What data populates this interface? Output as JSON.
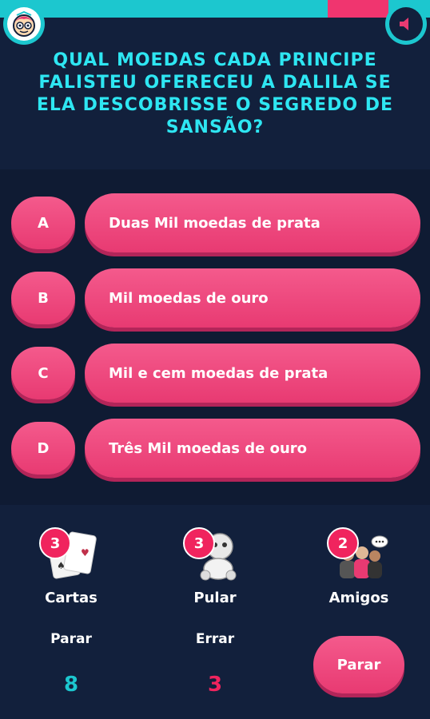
{
  "question": "QUAL MOEDAS CADA PRINCIPE FALISTEU OFERECEU A DALILA SE ELA DESCOBRISSE O SEGREDO DE SANSÃO?",
  "answers": [
    {
      "letter": "A",
      "text": "Duas Mil moedas de prata"
    },
    {
      "letter": "B",
      "text": "Mil moedas de ouro"
    },
    {
      "letter": "C",
      "text": "Mil e cem moedas de prata"
    },
    {
      "letter": "D",
      "text": "Três Mil moedas de ouro"
    }
  ],
  "lifelines": [
    {
      "label": "Cartas",
      "count": "3",
      "icon": "cards-icon"
    },
    {
      "label": "Pular",
      "count": "3",
      "icon": "skip-icon"
    },
    {
      "label": "Amigos",
      "count": "2",
      "icon": "friends-icon"
    }
  ],
  "stats": {
    "stop_label": "Parar",
    "stop_value": "8",
    "wrong_label": "Errar",
    "wrong_value": "3"
  },
  "stop_button": "Parar",
  "colors": {
    "background": "#12203c",
    "accent_cyan": "#1cc7cf",
    "question_text": "#2ee6f2",
    "button_pink": "#e83a72",
    "stop_value": "#1cc7cf",
    "wrong_value": "#f0245e"
  },
  "progress": {
    "timer_remaining_fraction": 0.14
  }
}
